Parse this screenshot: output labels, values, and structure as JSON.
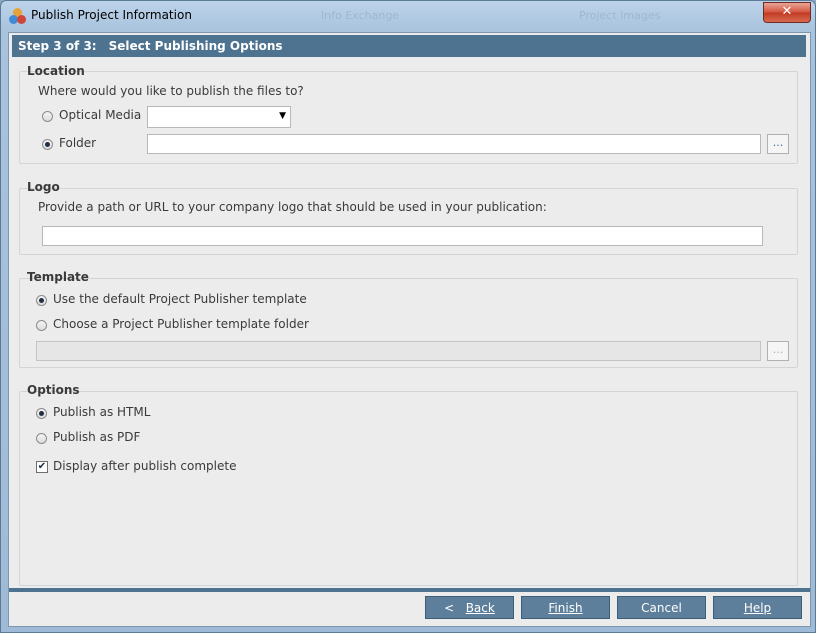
{
  "window": {
    "title": "Publish Project Information",
    "bg_item_1": "Info Exchange",
    "bg_item_2": "Project Images"
  },
  "step": {
    "number": "Step 3 of 3:",
    "title": "Select Publishing Options"
  },
  "location": {
    "legend": "Location",
    "prompt": "Where would you like to publish the files to?",
    "optical_label": "Optical Media",
    "optical_value": "",
    "folder_label": "Folder",
    "folder_value": "",
    "selected": "folder",
    "browse_label": "..."
  },
  "logo": {
    "legend": "Logo",
    "prompt": "Provide a path or URL to your company logo that should be used in your publication:",
    "value": ""
  },
  "template": {
    "legend": "Template",
    "default_label": "Use the default Project Publisher template",
    "choose_label": "Choose a Project Publisher template folder",
    "selected": "default",
    "folder_value": "",
    "browse_label": "..."
  },
  "options": {
    "legend": "Options",
    "html_label": "Publish as HTML",
    "pdf_label": "Publish as PDF",
    "selected": "html",
    "display_label": "Display after publish complete",
    "display_checked": true
  },
  "buttons": {
    "back_prefix": "<",
    "back_label": "Back",
    "finish_label": "Finish",
    "cancel_label": "Cancel",
    "help_label": "Help"
  },
  "colors": {
    "header": "#4d7390",
    "button": "#5d7f9b",
    "close": "#c03a22"
  }
}
